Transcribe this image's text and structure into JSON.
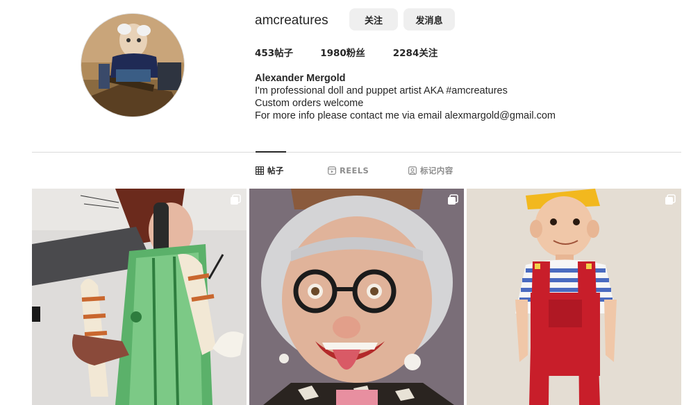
{
  "profile": {
    "username": "amcreatures",
    "follow_label": "关注",
    "message_label": "发消息",
    "stats": {
      "posts": "453帖子",
      "followers": "1980粉丝",
      "following": "2284关注"
    },
    "bio": {
      "name": "Alexander Mergold",
      "line1": "I'm professional doll and puppet artist AKA #amcreatures",
      "line2": "Custom orders welcome",
      "line3": "For more info please contact me via email alexmargold@gmail.com"
    }
  },
  "tabs": [
    {
      "label": "帖子",
      "icon": "grid-icon",
      "active": true
    },
    {
      "label": "REELS",
      "icon": "reels-icon",
      "active": false
    },
    {
      "label": "标记内容",
      "icon": "tagged-icon",
      "active": false
    }
  ],
  "posts": [
    {
      "subject": "puppet with green overalls held by hand",
      "icon": "multiple-posts-icon"
    },
    {
      "subject": "grandma puppet with glasses sticking out tongue",
      "icon": "multiple-posts-icon"
    },
    {
      "subject": "boy puppet in red overalls and yellow hat",
      "icon": "multiple-posts-icon"
    }
  ],
  "colors": {
    "text": "#262626",
    "secondary_text": "#8e8e8e",
    "button_bg": "#efefef",
    "divider": "#dbdbdb"
  }
}
